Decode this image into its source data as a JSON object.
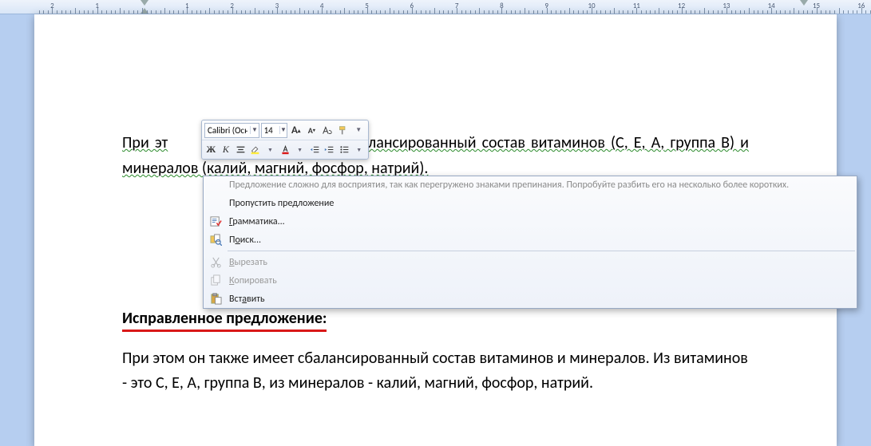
{
  "ruler": {
    "unit": "cm",
    "range": [
      0,
      17
    ]
  },
  "miniToolbar": {
    "font": "Calibri (Осн",
    "size": "14"
  },
  "document": {
    "para1_part1": "При эт",
    "para1_part2": " сбалансированный состав витаминов (С, Е, А, группа В) и минералов (калий, магний, фосфор, натрий).",
    "heading": "Исправленное предложение:",
    "para2": "При этом он также имеет сбалансированный состав витаминов и минералов. Из витаминов - это С, Е, А, группа В, из минералов - калий, магний, фосфор, натрий."
  },
  "contextMenu": {
    "suggestion": "Предложение сложно для восприятия, так как перегружено знаками препинания. Попробуйте разбить его на несколько более коротких.",
    "skip": "Пропустить предложение",
    "grammar": "Грамматика...",
    "search": "Поиск...",
    "cut": "Вырезать",
    "copy": "Копировать",
    "paste": "Вставить"
  }
}
